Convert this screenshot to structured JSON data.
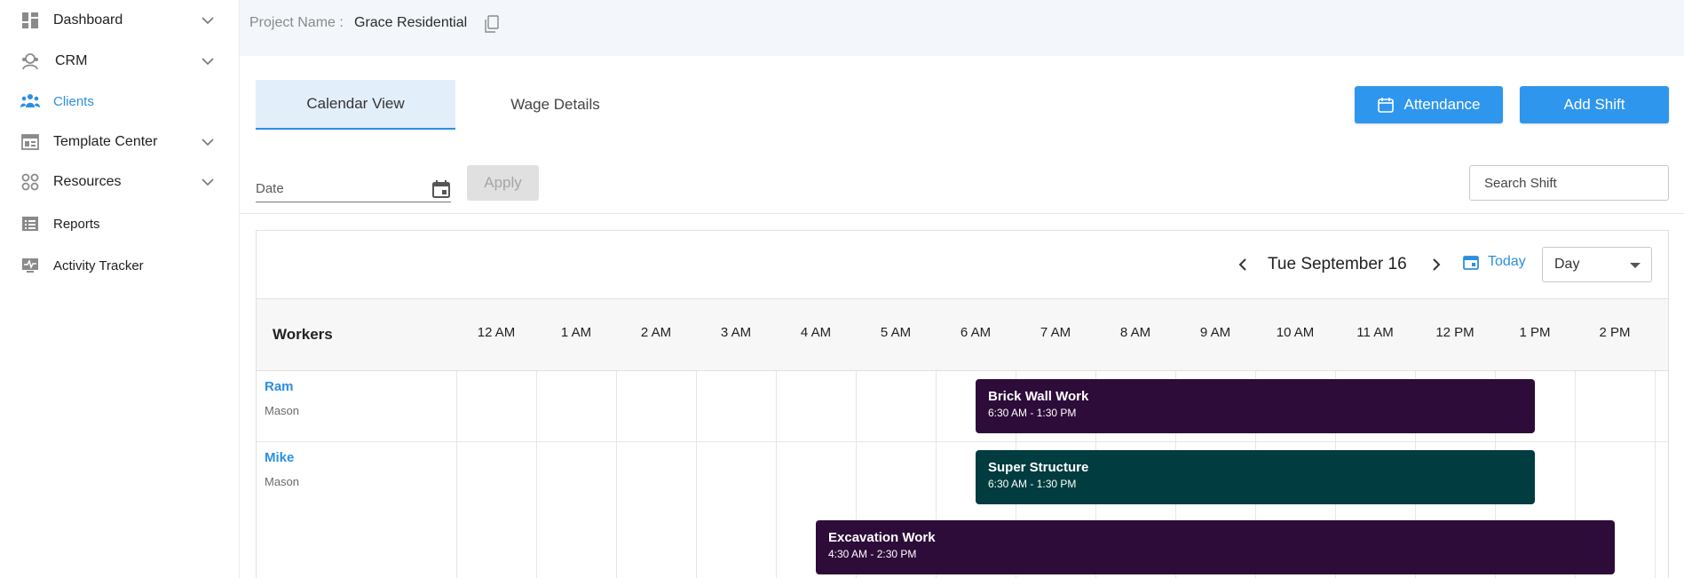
{
  "sidebar": {
    "items": [
      {
        "label": "Dashboard",
        "icon": "dashboard-icon",
        "expandable": true
      },
      {
        "label": "CRM",
        "icon": "crm-icon",
        "expandable": true
      },
      {
        "label": "Clients",
        "icon": "clients-icon",
        "active": true
      },
      {
        "label": "Template Center",
        "icon": "template-icon",
        "expandable": true
      },
      {
        "label": "Resources",
        "icon": "resources-icon",
        "expandable": true
      },
      {
        "label": "Reports",
        "icon": "reports-icon"
      },
      {
        "label": "Activity Tracker",
        "icon": "activity-icon"
      }
    ]
  },
  "project": {
    "label": "Project Name :",
    "value": "Grace Residential"
  },
  "tabs": [
    {
      "label": "Calendar View",
      "active": true
    },
    {
      "label": "Wage Details",
      "active": false
    }
  ],
  "actions": {
    "attendance_label": "Attendance",
    "add_shift_label": "Add Shift"
  },
  "filters": {
    "date_label": "Date",
    "apply_label": "Apply",
    "search_placeholder": "Search Shift"
  },
  "calendar": {
    "current_date": "Tue September 16",
    "today_label": "Today",
    "view": "Day",
    "workers_header": "Workers",
    "hours": [
      "12 AM",
      "1 AM",
      "2 AM",
      "3 AM",
      "4 AM",
      "5 AM",
      "6 AM",
      "7 AM",
      "8 AM",
      "9 AM",
      "10 AM",
      "11 AM",
      "12 PM",
      "1 PM",
      "2 PM"
    ],
    "workers": [
      {
        "name": "Ram",
        "role": "Mason"
      },
      {
        "name": "Mike",
        "role": "Mason"
      }
    ],
    "shifts": [
      {
        "title": "Brick Wall Work",
        "time": "6:30 AM - 1:30 PM"
      },
      {
        "title": "Super Structure",
        "time": "6:30 AM - 1:30 PM"
      },
      {
        "title": "Excavation Work",
        "time": "4:30 AM - 2:30 PM"
      }
    ]
  },
  "colors": {
    "accent": "#2f96ee",
    "link": "#2b8fe0",
    "shift_purple": "#2d0c39",
    "shift_teal": "#003c40",
    "header_bg": "#f3f7fc"
  }
}
